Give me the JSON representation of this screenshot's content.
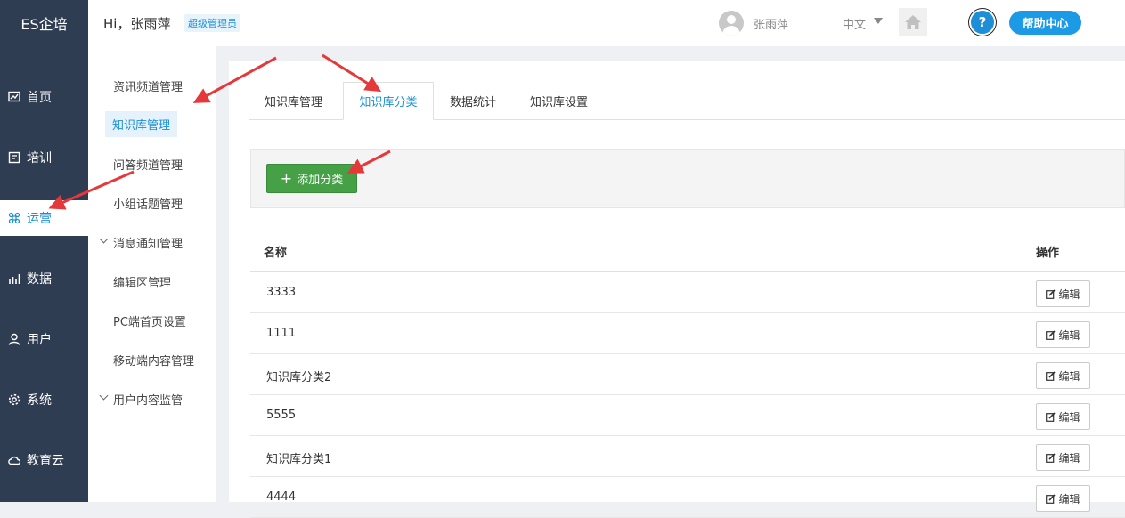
{
  "header": {
    "logo": "ES企培",
    "greeting": "Hi，张雨萍",
    "role_badge": "超级管理员",
    "username": "张雨萍",
    "language": "中文",
    "help_label": "帮助中心",
    "help_icon_glyph": "?"
  },
  "sidebar": {
    "items": [
      {
        "label": "首页",
        "icon": "chart-icon"
      },
      {
        "label": "培训",
        "icon": "book-icon"
      },
      {
        "label": "运营",
        "icon": "command-icon",
        "active": true
      },
      {
        "label": "数据",
        "icon": "bar-chart-icon"
      },
      {
        "label": "用户",
        "icon": "user-icon"
      },
      {
        "label": "系统",
        "icon": "gear-icon"
      },
      {
        "label": "教育云",
        "icon": "cloud-icon"
      }
    ]
  },
  "subnav": {
    "items": [
      {
        "label": "资讯频道管理"
      },
      {
        "label": "知识库管理",
        "active": true
      },
      {
        "label": "问答频道管理"
      },
      {
        "label": "小组话题管理"
      },
      {
        "label": "消息通知管理",
        "expandable": true
      },
      {
        "label": "编辑区管理"
      },
      {
        "label": "PC端首页设置"
      },
      {
        "label": "移动端内容管理"
      },
      {
        "label": "用户内容监管",
        "expandable": true
      }
    ]
  },
  "tabs": [
    {
      "label": "知识库管理"
    },
    {
      "label": "知识库分类",
      "active": true
    },
    {
      "label": "数据统计"
    },
    {
      "label": "知识库设置"
    }
  ],
  "toolbar": {
    "add_label": "添加分类",
    "add_icon": "+"
  },
  "table": {
    "columns": [
      "名称",
      "操作"
    ],
    "edit_label": "编辑",
    "rows": [
      "3333",
      "1111",
      "知识库分类2",
      "5555",
      "知识库分类1",
      "4444"
    ]
  },
  "colors": {
    "sidebar_bg": "#2f3d52",
    "accent": "#1c8fd6",
    "add_button": "#45a046",
    "arrow": "#e5383b"
  }
}
